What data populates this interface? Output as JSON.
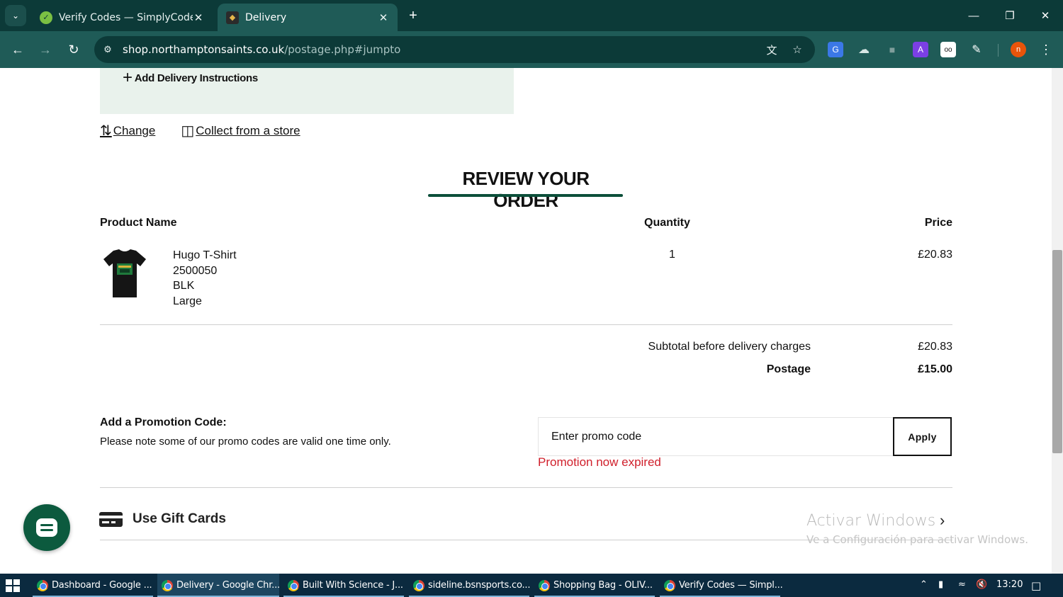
{
  "browser": {
    "tabs": [
      {
        "title": "Verify Codes — SimplyCodes",
        "active": false
      },
      {
        "title": "Delivery",
        "active": true
      }
    ],
    "url_host": "shop.northamptonsaints.co.uk",
    "url_path": "/postage.php#jumpto",
    "profile_initial": "n",
    "extension_icons": [
      "translate-icon",
      "star-icon",
      "google-translate-ext-icon",
      "cloud-ext-icon",
      "bag-ext-icon",
      "letter-a-ext-icon",
      "reader-ext-icon",
      "puzzle-icon",
      "profile-avatar",
      "kebab-menu-icon"
    ]
  },
  "delivery": {
    "add_instructions": "Add Delivery Instructions",
    "change_link": "Change",
    "collect_link": "Collect from a store"
  },
  "review": {
    "title": "REVIEW YOUR ORDER",
    "accent_color": "#0c4f3a",
    "columns": {
      "product": "Product Name",
      "quantity": "Quantity",
      "price": "Price"
    },
    "items": [
      {
        "name": "Hugo T-Shirt",
        "code": "2500050",
        "colour": "BLK",
        "size": "Large",
        "quantity": "1",
        "price": "£20.83"
      }
    ],
    "subtotal_label": "Subtotal before delivery charges",
    "subtotal_value": "£20.83",
    "postage_label": "Postage",
    "postage_value": "£15.00"
  },
  "promo": {
    "title": "Add a Promotion Code:",
    "note": "Please note some of our promo codes are valid one time only.",
    "placeholder": "Enter promo code",
    "apply_label": "Apply",
    "error": "Promotion now expired",
    "error_color": "#d0202c"
  },
  "gift_cards": {
    "label": "Use Gift Cards"
  },
  "watermark": {
    "line1": "Activar Windows",
    "line2": "Ve a Configuración para activar Windows."
  },
  "taskbar": {
    "items": [
      {
        "label": "Dashboard - Google ...",
        "active": false
      },
      {
        "label": "Delivery - Google Chr...",
        "active": true
      },
      {
        "label": "Built With Science - J...",
        "active": false
      },
      {
        "label": "sideline.bsnsports.co...",
        "active": false
      },
      {
        "label": "Shopping Bag - OLIV...",
        "active": false
      },
      {
        "label": "Verify Codes — Simpl...",
        "active": false
      }
    ],
    "clock": "13:20"
  }
}
